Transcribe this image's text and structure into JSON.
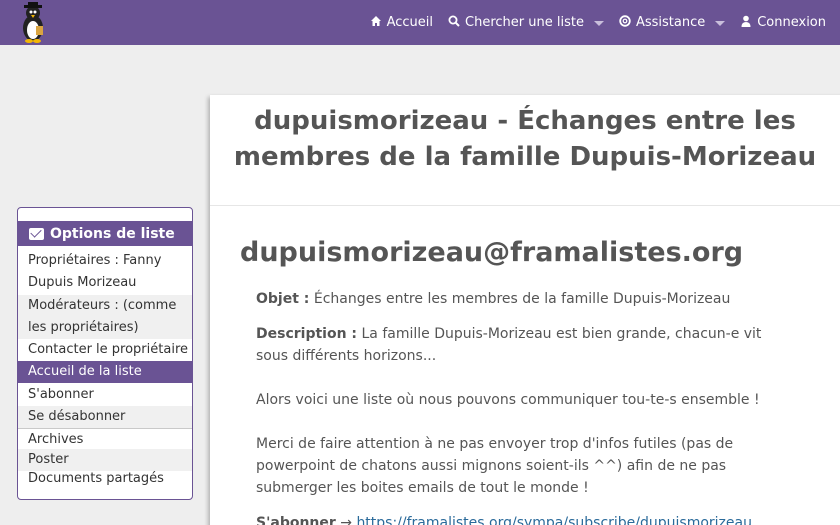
{
  "nav": {
    "home": "Accueil",
    "search": "Chercher une liste",
    "help": "Assistance",
    "login": "Connexion"
  },
  "sidebar": {
    "title": "Options de liste",
    "items": [
      "Propriétaires : Fanny",
      "Dupuis Morizeau",
      "Modérateurs : (comme",
      "les propriétaires)",
      "Contacter le propriétaire",
      "Accueil de la liste",
      "S'abonner",
      "Se désabonner",
      "Archives",
      "Poster",
      "Documents partagés"
    ]
  },
  "main": {
    "title_line1": "dupuismorizeau - Échanges entre les",
    "title_line2": "membres de la famille Dupuis-Morizeau",
    "address": "dupuismorizeau@framalistes.org",
    "subject_label": "Objet :",
    "subject_value": "Échanges entre les membres de la famille Dupuis-Morizeau",
    "description_label": "Description :",
    "description_line1": "La famille Dupuis-Morizeau est bien grande, chacun-e vit",
    "description_line2": "sous différents horizons...",
    "para2": "Alors voici une liste où nous pouvons communiquer tou-te-s ensemble !",
    "para3_line1": "Merci de faire attention à ne pas envoyer trop d'infos futiles (pas de",
    "para3_line2": "powerpoint de chatons aussi mignons soient-ils ^^) afin de ne pas",
    "para3_line3": "submerger les boites emails de tout le monde !",
    "subscribe_label": "S'abonner",
    "subscribe_arrow": "→",
    "subscribe_link": "https://framalistes.org/sympa/subscribe/dupuismorizeau"
  },
  "colors": {
    "brand": "#6a5394",
    "text": "#555555",
    "link": "#2a6a9a"
  }
}
